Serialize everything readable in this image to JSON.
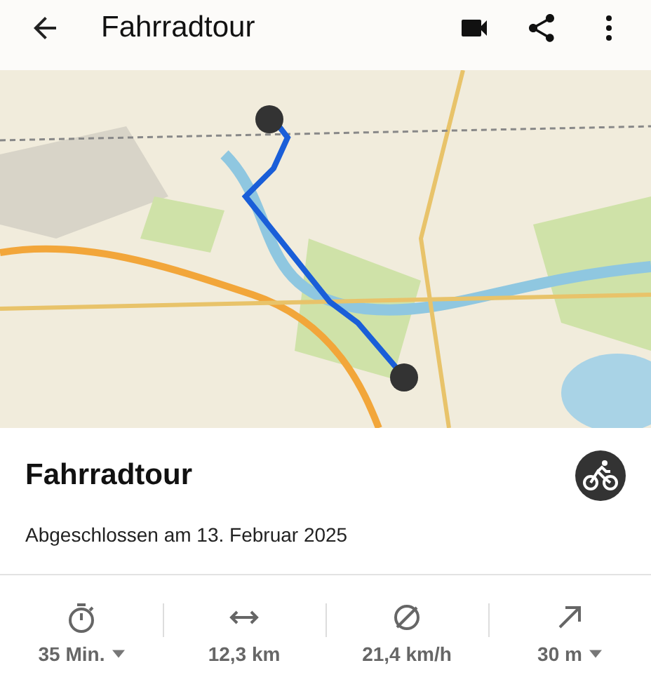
{
  "app_bar": {
    "title": "Fahrradtour"
  },
  "activity": {
    "title": "Fahrradtour",
    "subtitle": "Abgeschlossen am 13. Februar 2025"
  },
  "stats": [
    {
      "kind": "duration",
      "value": "35 Min.",
      "dropdown": true
    },
    {
      "kind": "distance",
      "value": "12,3 km",
      "dropdown": false
    },
    {
      "kind": "speed",
      "value": "21,4 km/h",
      "dropdown": false
    },
    {
      "kind": "elevation",
      "value": "30 m",
      "dropdown": true
    }
  ]
}
